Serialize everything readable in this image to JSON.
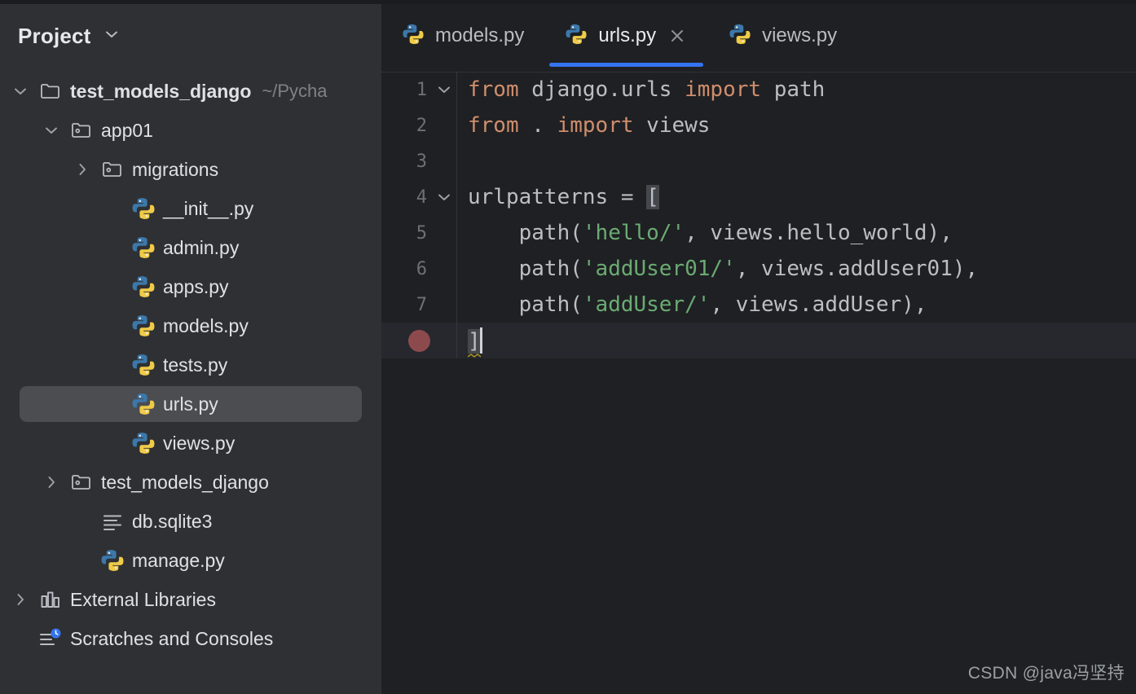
{
  "sidebar": {
    "header": {
      "title": "Project",
      "chevron_icon": "chevron-down-icon"
    },
    "tree": [
      {
        "label": "test_models_django",
        "suffix": "~/Pycha",
        "icon": "folder-icon",
        "twisty": "chevron-down-icon",
        "indent": 1,
        "bold": true,
        "selected": false
      },
      {
        "label": "app01",
        "suffix": "",
        "icon": "module-folder-icon",
        "twisty": "chevron-down-icon",
        "indent": 2,
        "bold": false,
        "selected": false
      },
      {
        "label": "migrations",
        "suffix": "",
        "icon": "module-folder-icon",
        "twisty": "chevron-right-icon",
        "indent": 3,
        "bold": false,
        "selected": false
      },
      {
        "label": "__init__.py",
        "suffix": "",
        "icon": "python-file-icon",
        "twisty": "",
        "indent": 4,
        "bold": false,
        "selected": false
      },
      {
        "label": "admin.py",
        "suffix": "",
        "icon": "python-file-icon",
        "twisty": "",
        "indent": 4,
        "bold": false,
        "selected": false
      },
      {
        "label": "apps.py",
        "suffix": "",
        "icon": "python-file-icon",
        "twisty": "",
        "indent": 4,
        "bold": false,
        "selected": false
      },
      {
        "label": "models.py",
        "suffix": "",
        "icon": "python-file-icon",
        "twisty": "",
        "indent": 4,
        "bold": false,
        "selected": false
      },
      {
        "label": "tests.py",
        "suffix": "",
        "icon": "python-file-icon",
        "twisty": "",
        "indent": 4,
        "bold": false,
        "selected": false
      },
      {
        "label": "urls.py",
        "suffix": "",
        "icon": "python-file-icon",
        "twisty": "",
        "indent": 4,
        "bold": false,
        "selected": true
      },
      {
        "label": "views.py",
        "suffix": "",
        "icon": "python-file-icon",
        "twisty": "",
        "indent": 4,
        "bold": false,
        "selected": false
      },
      {
        "label": "test_models_django",
        "suffix": "",
        "icon": "module-folder-icon",
        "twisty": "chevron-right-icon",
        "indent": 2,
        "bold": false,
        "selected": false
      },
      {
        "label": "db.sqlite3",
        "suffix": "",
        "icon": "database-file-icon",
        "twisty": "",
        "indent": 3,
        "bold": false,
        "selected": false
      },
      {
        "label": "manage.py",
        "suffix": "",
        "icon": "python-file-icon",
        "twisty": "",
        "indent": 3,
        "bold": false,
        "selected": false
      },
      {
        "label": "External Libraries",
        "suffix": "",
        "icon": "libraries-icon",
        "twisty": "chevron-right-icon",
        "indent": 1,
        "bold": false,
        "selected": false
      },
      {
        "label": "Scratches and Consoles",
        "suffix": "",
        "icon": "scratches-icon",
        "twisty": "",
        "indent": 1,
        "bold": false,
        "selected": false
      }
    ]
  },
  "editor": {
    "tabs": [
      {
        "label": "models.py",
        "icon": "python-file-icon",
        "active": false,
        "closable": false
      },
      {
        "label": "urls.py",
        "icon": "python-file-icon",
        "active": true,
        "closable": true
      },
      {
        "label": "views.py",
        "icon": "python-file-icon",
        "active": false,
        "closable": false
      }
    ],
    "close_icon": "close-icon",
    "accent_color": "#3574f0",
    "lines": [
      {
        "number": "1",
        "fold": "chevron-down-icon",
        "breakpoint": false,
        "current": false,
        "tokens": [
          {
            "t": "from",
            "c": "kw"
          },
          {
            "t": " django.urls ",
            "c": "plain"
          },
          {
            "t": "import",
            "c": "kw"
          },
          {
            "t": " path",
            "c": "plain"
          }
        ]
      },
      {
        "number": "2",
        "fold": "",
        "breakpoint": false,
        "current": false,
        "tokens": [
          {
            "t": "from",
            "c": "kw"
          },
          {
            "t": " . ",
            "c": "plain"
          },
          {
            "t": "import",
            "c": "kw"
          },
          {
            "t": " views",
            "c": "plain"
          }
        ]
      },
      {
        "number": "3",
        "fold": "",
        "breakpoint": false,
        "current": false,
        "tokens": []
      },
      {
        "number": "4",
        "fold": "chevron-down-icon",
        "breakpoint": false,
        "current": false,
        "tokens": [
          {
            "t": "urlpatterns = ",
            "c": "plain"
          },
          {
            "t": "[",
            "c": "brhl"
          }
        ]
      },
      {
        "number": "5",
        "fold": "",
        "breakpoint": false,
        "current": false,
        "tokens": [
          {
            "t": "    path(",
            "c": "plain"
          },
          {
            "t": "'hello/'",
            "c": "str"
          },
          {
            "t": ", views.hello_world),",
            "c": "plain"
          }
        ]
      },
      {
        "number": "6",
        "fold": "",
        "breakpoint": false,
        "current": false,
        "tokens": [
          {
            "t": "    path(",
            "c": "plain"
          },
          {
            "t": "'addUser01/'",
            "c": "str"
          },
          {
            "t": ", views.addUser01),",
            "c": "plain"
          }
        ]
      },
      {
        "number": "7",
        "fold": "",
        "breakpoint": false,
        "current": false,
        "tokens": [
          {
            "t": "    path(",
            "c": "plain"
          },
          {
            "t": "'addUser/'",
            "c": "str"
          },
          {
            "t": ", views.addUser),",
            "c": "plain"
          }
        ]
      },
      {
        "number": "",
        "fold": "",
        "breakpoint": true,
        "current": true,
        "tokens": [
          {
            "t": "]",
            "c": "brhl"
          }
        ],
        "caret": true,
        "squiggle": true
      }
    ]
  },
  "watermark": {
    "text": "CSDN @java冯坚持"
  }
}
